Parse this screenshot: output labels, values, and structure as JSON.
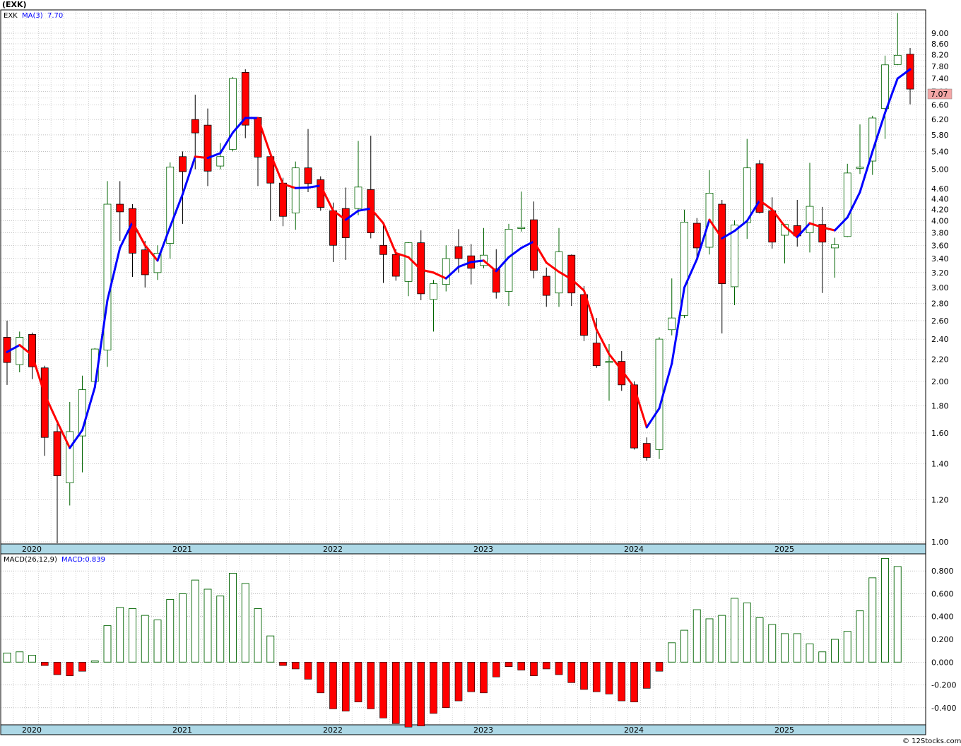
{
  "header": {
    "title": "(EXK)"
  },
  "price_legend": {
    "symbol": "EXK",
    "ma_label": "MA(3)",
    "ma_value": "7.70"
  },
  "macd_legend": {
    "name": "MACD(26,12,9)",
    "macd_value": "MACD:0.839"
  },
  "last_price_badge": "7.07",
  "footer": {
    "credit": "© 12Stocks.com"
  },
  "colors": {
    "up": "#ffffff",
    "up_border": "#006400",
    "down": "#ff0000",
    "ma_up": "#0000ff",
    "ma_down": "#ff0000",
    "macd_pos_border": "#006400",
    "macd_neg": "#ff0000",
    "axis_band": "#add8e6"
  },
  "chart_data": [
    {
      "type": "candlestick",
      "symbol": "EXK",
      "scale": "log",
      "ylim": [
        1.0,
        9.0
      ],
      "y_ticks": [
        "1.00",
        "1.20",
        "1.40",
        "1.60",
        "1.80",
        "2.00",
        "2.20",
        "2.40",
        "2.60",
        "2.80",
        "3.00",
        "3.20",
        "3.40",
        "3.60",
        "3.80",
        "4.00",
        "4.20",
        "4.40",
        "4.60",
        "5.00",
        "5.40",
        "5.80",
        "6.20",
        "6.60",
        "7.00",
        "7.40",
        "7.80",
        "8.20",
        "8.60",
        "9.00"
      ],
      "x_labels": [
        "2020",
        "2021",
        "2022",
        "2023",
        "2024",
        "2025"
      ],
      "candles": [
        {
          "date": "2020-01",
          "o": 2.42,
          "h": 2.6,
          "l": 1.97,
          "c": 2.17
        },
        {
          "date": "2020-02",
          "o": 2.15,
          "h": 2.48,
          "l": 2.08,
          "c": 2.42
        },
        {
          "date": "2020-03",
          "o": 2.45,
          "h": 2.47,
          "l": 2.02,
          "c": 2.13
        },
        {
          "date": "2020-04",
          "o": 2.12,
          "h": 2.14,
          "l": 1.45,
          "c": 1.57
        },
        {
          "date": "2020-05",
          "o": 1.61,
          "h": 1.68,
          "l": 0.98,
          "c": 1.33
        },
        {
          "date": "2020-06",
          "o": 1.29,
          "h": 1.83,
          "l": 1.17,
          "c": 1.61
        },
        {
          "date": "2020-07",
          "o": 1.58,
          "h": 2.05,
          "l": 1.35,
          "c": 1.93
        },
        {
          "date": "2020-08",
          "o": 2.0,
          "h": 2.31,
          "l": 1.97,
          "c": 2.3
        },
        {
          "date": "2020-09",
          "o": 2.29,
          "h": 4.75,
          "l": 2.13,
          "c": 4.3
        },
        {
          "date": "2020-10",
          "o": 4.3,
          "h": 4.75,
          "l": 3.67,
          "c": 4.16
        },
        {
          "date": "2020-11",
          "o": 4.22,
          "h": 4.3,
          "l": 3.14,
          "c": 3.48
        },
        {
          "date": "2020-12",
          "o": 3.53,
          "h": 3.67,
          "l": 3.0,
          "c": 3.17
        },
        {
          "date": "2021-01",
          "o": 3.2,
          "h": 3.6,
          "l": 3.1,
          "c": 3.48
        },
        {
          "date": "2021-02",
          "o": 3.63,
          "h": 5.15,
          "l": 3.4,
          "c": 5.05
        },
        {
          "date": "2021-03",
          "o": 5.28,
          "h": 5.4,
          "l": 3.95,
          "c": 4.95
        },
        {
          "date": "2021-04",
          "o": 6.2,
          "h": 6.9,
          "l": 5.0,
          "c": 5.85
        },
        {
          "date": "2021-05",
          "o": 6.05,
          "h": 6.5,
          "l": 4.65,
          "c": 4.96
        },
        {
          "date": "2021-06",
          "o": 5.07,
          "h": 5.6,
          "l": 5.0,
          "c": 5.28
        },
        {
          "date": "2021-07",
          "o": 5.45,
          "h": 7.45,
          "l": 5.4,
          "c": 7.4
        },
        {
          "date": "2021-08",
          "o": 7.6,
          "h": 7.7,
          "l": 5.72,
          "c": 6.05
        },
        {
          "date": "2021-09",
          "o": 6.25,
          "h": 6.25,
          "l": 4.65,
          "c": 5.27
        },
        {
          "date": "2021-10",
          "o": 5.28,
          "h": 5.4,
          "l": 4.0,
          "c": 4.71
        },
        {
          "date": "2021-11",
          "o": 4.71,
          "h": 4.82,
          "l": 3.91,
          "c": 4.08
        },
        {
          "date": "2021-12",
          "o": 4.14,
          "h": 5.17,
          "l": 3.85,
          "c": 5.03
        },
        {
          "date": "2022-01",
          "o": 5.03,
          "h": 5.95,
          "l": 4.53,
          "c": 4.7
        },
        {
          "date": "2022-02",
          "o": 4.78,
          "h": 4.85,
          "l": 4.18,
          "c": 4.24
        },
        {
          "date": "2022-03",
          "o": 4.18,
          "h": 4.33,
          "l": 3.35,
          "c": 3.6
        },
        {
          "date": "2022-04",
          "o": 4.22,
          "h": 4.62,
          "l": 3.38,
          "c": 3.72
        },
        {
          "date": "2022-05",
          "o": 4.22,
          "h": 5.65,
          "l": 4.1,
          "c": 4.63
        },
        {
          "date": "2022-06",
          "o": 4.58,
          "h": 5.78,
          "l": 3.71,
          "c": 3.8
        },
        {
          "date": "2022-07",
          "o": 3.6,
          "h": 3.98,
          "l": 3.06,
          "c": 3.46
        },
        {
          "date": "2022-08",
          "o": 3.46,
          "h": 3.54,
          "l": 3.09,
          "c": 3.15
        },
        {
          "date": "2022-09",
          "o": 3.08,
          "h": 3.65,
          "l": 2.89,
          "c": 3.64
        },
        {
          "date": "2022-10",
          "o": 3.64,
          "h": 3.84,
          "l": 2.84,
          "c": 2.92
        },
        {
          "date": "2022-11",
          "o": 2.85,
          "h": 3.1,
          "l": 2.48,
          "c": 3.05
        },
        {
          "date": "2022-12",
          "o": 3.04,
          "h": 3.6,
          "l": 2.95,
          "c": 3.4
        },
        {
          "date": "2023-01",
          "o": 3.58,
          "h": 3.86,
          "l": 3.2,
          "c": 3.4
        },
        {
          "date": "2023-02",
          "o": 3.44,
          "h": 3.62,
          "l": 3.04,
          "c": 3.26
        },
        {
          "date": "2023-03",
          "o": 3.3,
          "h": 3.88,
          "l": 3.26,
          "c": 3.45
        },
        {
          "date": "2023-04",
          "o": 3.25,
          "h": 3.54,
          "l": 2.86,
          "c": 2.94
        },
        {
          "date": "2023-05",
          "o": 2.95,
          "h": 3.95,
          "l": 2.77,
          "c": 3.86
        },
        {
          "date": "2023-06",
          "o": 3.87,
          "h": 4.54,
          "l": 3.82,
          "c": 3.89
        },
        {
          "date": "2023-07",
          "o": 4.02,
          "h": 4.35,
          "l": 3.12,
          "c": 3.23
        },
        {
          "date": "2023-08",
          "o": 3.15,
          "h": 3.27,
          "l": 2.76,
          "c": 2.9
        },
        {
          "date": "2023-09",
          "o": 2.93,
          "h": 3.88,
          "l": 2.76,
          "c": 3.5
        },
        {
          "date": "2023-10",
          "o": 3.45,
          "h": 3.46,
          "l": 2.77,
          "c": 2.93
        },
        {
          "date": "2023-11",
          "o": 2.91,
          "h": 3.02,
          "l": 2.38,
          "c": 2.44
        },
        {
          "date": "2023-12",
          "o": 2.36,
          "h": 2.63,
          "l": 2.12,
          "c": 2.14
        },
        {
          "date": "2024-01",
          "o": 2.17,
          "h": 2.35,
          "l": 1.84,
          "c": 2.18
        },
        {
          "date": "2024-02",
          "o": 2.18,
          "h": 2.28,
          "l": 1.92,
          "c": 1.97
        },
        {
          "date": "2024-03",
          "o": 1.97,
          "h": 2.0,
          "l": 1.49,
          "c": 1.5
        },
        {
          "date": "2024-04",
          "o": 1.53,
          "h": 1.57,
          "l": 1.42,
          "c": 1.44
        },
        {
          "date": "2024-05",
          "o": 1.49,
          "h": 2.42,
          "l": 1.43,
          "c": 2.4
        },
        {
          "date": "2024-06",
          "o": 2.5,
          "h": 3.12,
          "l": 2.44,
          "c": 2.63
        },
        {
          "date": "2024-07",
          "o": 2.66,
          "h": 4.2,
          "l": 2.63,
          "c": 3.98
        },
        {
          "date": "2024-08",
          "o": 3.96,
          "h": 4.05,
          "l": 3.41,
          "c": 3.56
        },
        {
          "date": "2024-09",
          "o": 3.57,
          "h": 4.98,
          "l": 3.46,
          "c": 4.51
        },
        {
          "date": "2024-10",
          "o": 4.3,
          "h": 4.38,
          "l": 2.46,
          "c": 3.05
        },
        {
          "date": "2024-11",
          "o": 3.01,
          "h": 4.01,
          "l": 2.78,
          "c": 3.93
        },
        {
          "date": "2024-12",
          "o": 3.97,
          "h": 5.7,
          "l": 3.7,
          "c": 5.03
        },
        {
          "date": "2025-01",
          "o": 5.12,
          "h": 5.2,
          "l": 4.13,
          "c": 4.15
        },
        {
          "date": "2025-02",
          "o": 4.18,
          "h": 4.43,
          "l": 3.55,
          "c": 3.65
        },
        {
          "date": "2025-03",
          "o": 3.76,
          "h": 3.93,
          "l": 3.33,
          "c": 3.94
        },
        {
          "date": "2025-04",
          "o": 3.92,
          "h": 4.38,
          "l": 3.58,
          "c": 3.75
        },
        {
          "date": "2025-05",
          "o": 3.8,
          "h": 5.14,
          "l": 3.49,
          "c": 4.26
        },
        {
          "date": "2025-06",
          "o": 3.94,
          "h": 4.25,
          "l": 2.93,
          "c": 3.65
        },
        {
          "date": "2025-07",
          "o": 3.56,
          "h": 3.72,
          "l": 3.13,
          "c": 3.61
        },
        {
          "date": "2025-08",
          "o": 3.74,
          "h": 5.12,
          "l": 3.73,
          "c": 4.92
        },
        {
          "date": "2025-09",
          "o": 5.02,
          "h": 6.07,
          "l": 4.9,
          "c": 5.05
        },
        {
          "date": "2025-10",
          "o": 5.18,
          "h": 6.3,
          "l": 4.88,
          "c": 6.24
        },
        {
          "date": "2025-11",
          "o": 6.5,
          "h": 8.17,
          "l": 5.7,
          "c": 7.85
        },
        {
          "date": "2025-12",
          "o": 7.86,
          "h": 9.82,
          "l": 7.84,
          "c": 8.18
        },
        {
          "date": "2026-01",
          "o": 8.22,
          "h": 8.44,
          "l": 6.62,
          "c": 7.07
        }
      ],
      "ma3": [
        2.27,
        2.34,
        2.24,
        1.89,
        1.68,
        1.5,
        1.62,
        1.95,
        2.84,
        3.56,
        3.98,
        3.6,
        3.37,
        3.9,
        4.49,
        5.28,
        5.25,
        5.36,
        5.86,
        6.24,
        6.24,
        5.34,
        4.69,
        4.61,
        4.62,
        4.66,
        4.18,
        4.02,
        4.18,
        4.22,
        3.96,
        3.48,
        3.42,
        3.24,
        3.2,
        3.12,
        3.28,
        3.35,
        3.37,
        3.22,
        3.42,
        3.56,
        3.66,
        3.34,
        3.21,
        3.11,
        2.96,
        2.5,
        2.25,
        2.1,
        1.95,
        1.64,
        1.78,
        2.16,
        3.0,
        3.39,
        4.02,
        3.71,
        3.83,
        4.0,
        4.37,
        4.2,
        3.91,
        3.73,
        3.96,
        3.89,
        3.84,
        4.06,
        4.53,
        5.4,
        6.38,
        7.4,
        7.7
      ],
      "macd_name": "MACD(26,12,9)",
      "macd_ylim": [
        -0.55,
        0.95
      ],
      "macd_ticks": [
        "-0.400",
        "-0.200",
        "0.000",
        "0.200",
        "0.400",
        "0.600",
        "0.800"
      ],
      "macd": [
        0.08,
        0.09,
        0.06,
        -0.03,
        -0.11,
        -0.12,
        -0.08,
        0.01,
        0.32,
        0.48,
        0.47,
        0.41,
        0.37,
        0.55,
        0.6,
        0.72,
        0.64,
        0.58,
        0.78,
        0.69,
        0.47,
        0.23,
        -0.03,
        -0.06,
        -0.15,
        -0.27,
        -0.41,
        -0.43,
        -0.35,
        -0.41,
        -0.49,
        -0.54,
        -0.57,
        -0.56,
        -0.45,
        -0.4,
        -0.34,
        -0.26,
        -0.27,
        -0.13,
        -0.04,
        -0.07,
        -0.12,
        -0.06,
        -0.11,
        -0.18,
        -0.24,
        -0.26,
        -0.28,
        -0.34,
        -0.35,
        -0.23,
        -0.08,
        0.17,
        0.28,
        0.46,
        0.38,
        0.41,
        0.56,
        0.52,
        0.39,
        0.33,
        0.25,
        0.25,
        0.16,
        0.09,
        0.2,
        0.27,
        0.45,
        0.74,
        0.91,
        0.839
      ]
    }
  ]
}
